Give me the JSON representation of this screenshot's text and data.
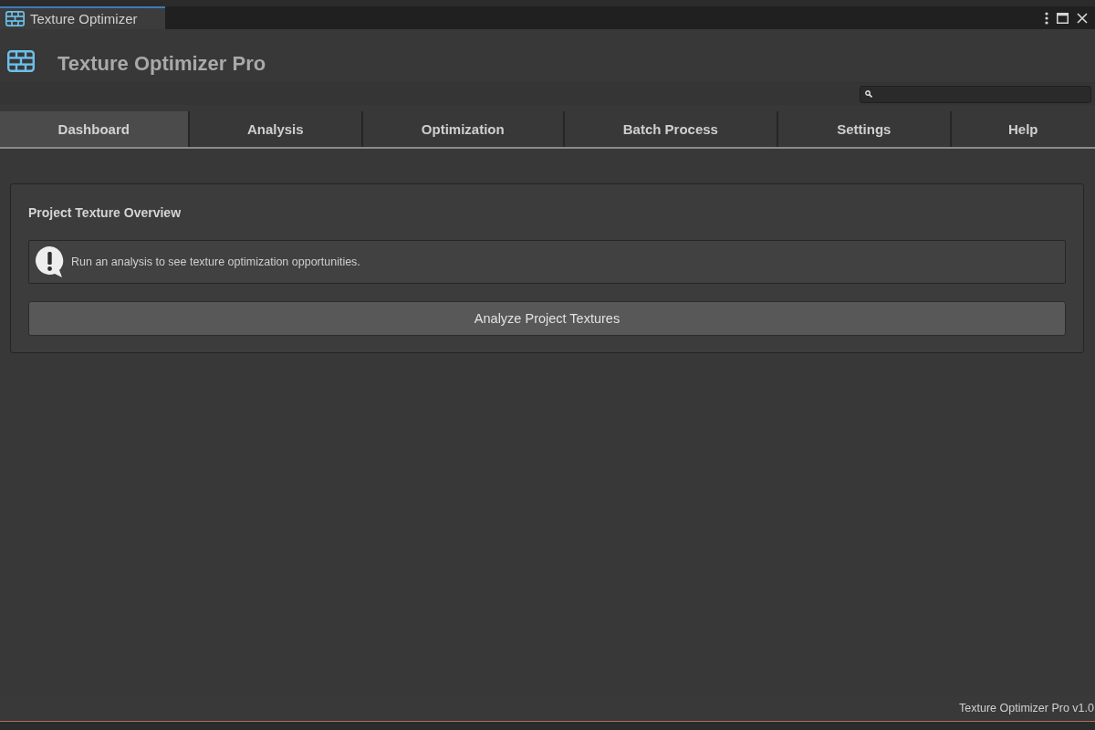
{
  "window": {
    "title": "Texture Optimizer"
  },
  "header": {
    "title": "Texture Optimizer Pro"
  },
  "tabs": [
    {
      "label": "Dashboard",
      "selected": true
    },
    {
      "label": "Analysis",
      "selected": false
    },
    {
      "label": "Optimization",
      "selected": false
    },
    {
      "label": "Batch Process",
      "selected": false
    },
    {
      "label": "Settings",
      "selected": false
    },
    {
      "label": "Help",
      "selected": false
    }
  ],
  "panel": {
    "title": "Project Texture Overview",
    "message": "Run an analysis to see texture optimization opportunities.",
    "button": "Analyze Project Textures"
  },
  "status_bar": {
    "text": "Texture Optimizer Pro v1.0"
  }
}
